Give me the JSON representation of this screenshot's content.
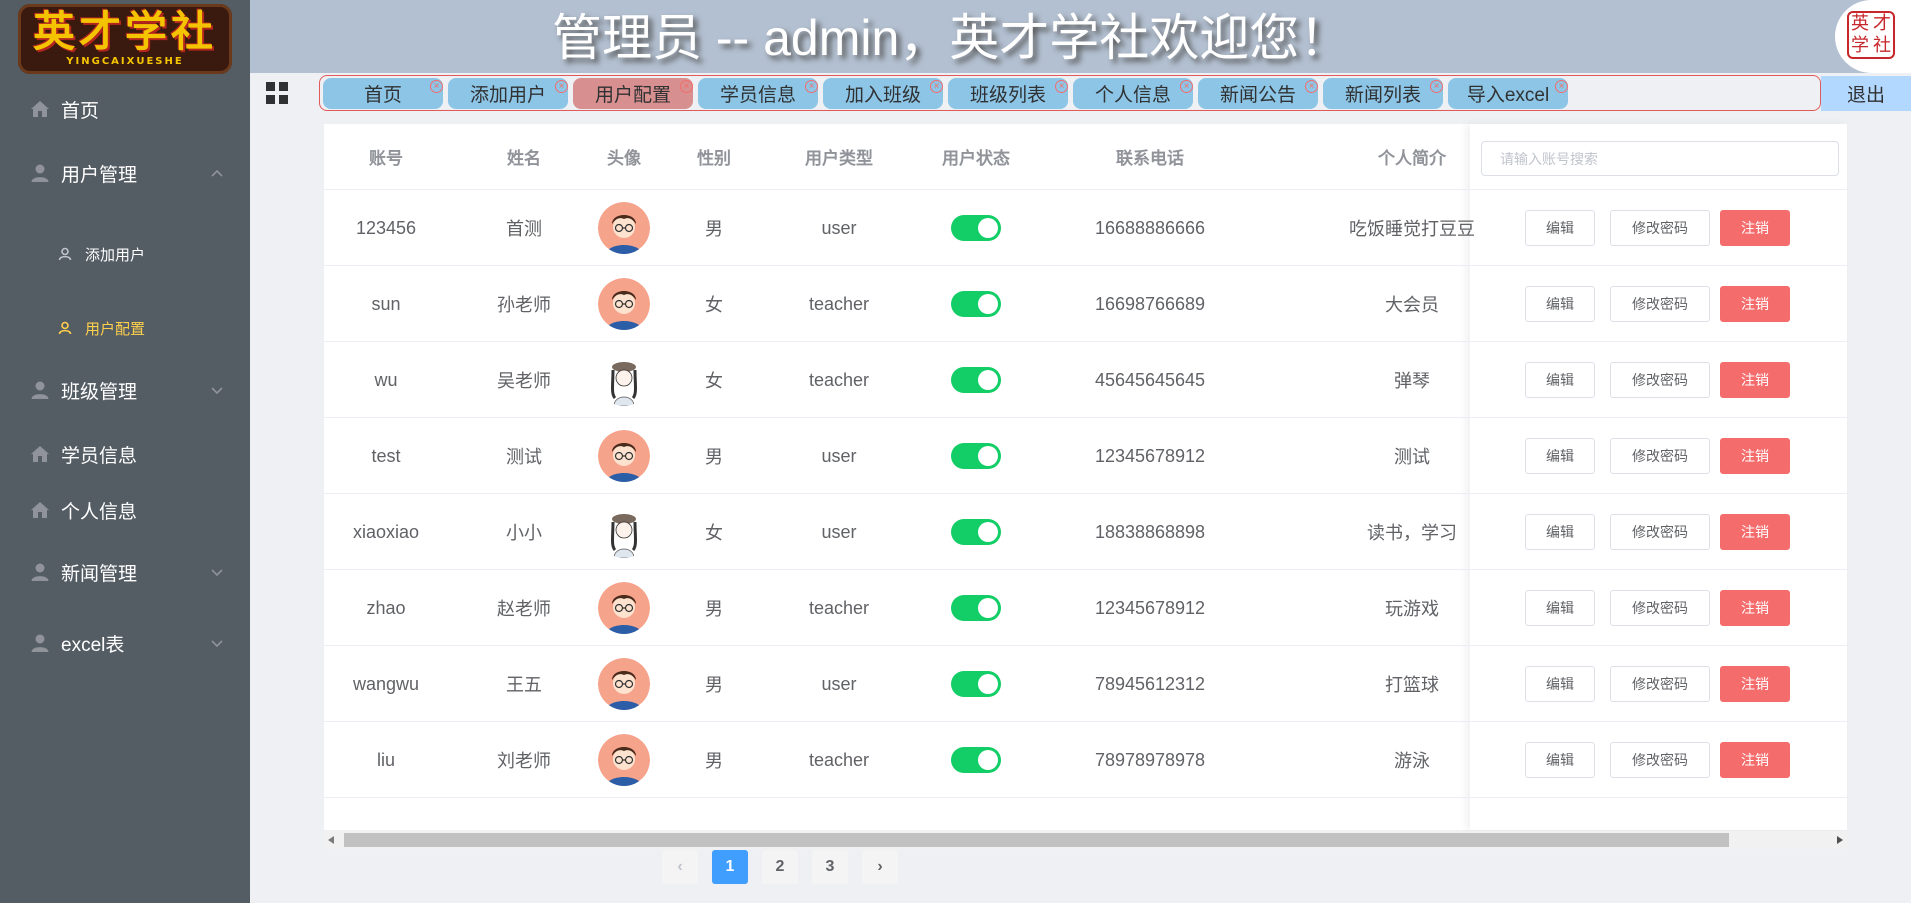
{
  "logo": {
    "main": "英才学社",
    "sub": "YINGCAIXUESHE"
  },
  "header": {
    "welcome": "管理员 -- admin，英才学社欢迎您！",
    "seal_chars": [
      "英",
      "才",
      "学",
      "社"
    ],
    "logout": "退出"
  },
  "sidebar": {
    "items": [
      {
        "label": "首页",
        "icon": "home-icon"
      },
      {
        "label": "用户管理",
        "icon": "user-icon",
        "expanded": true,
        "children": [
          {
            "label": "添加用户"
          },
          {
            "label": "用户配置",
            "active": true
          }
        ]
      },
      {
        "label": "班级管理",
        "icon": "user-icon"
      },
      {
        "label": "学员信息",
        "icon": "home-icon"
      },
      {
        "label": "个人信息",
        "icon": "home-icon"
      },
      {
        "label": "新闻管理",
        "icon": "user-icon"
      },
      {
        "label": "excel表",
        "icon": "user-icon"
      }
    ]
  },
  "tabs": [
    {
      "label": "首页"
    },
    {
      "label": "添加用户"
    },
    {
      "label": "用户配置",
      "active": true
    },
    {
      "label": "学员信息"
    },
    {
      "label": "加入班级"
    },
    {
      "label": "班级列表"
    },
    {
      "label": "个人信息"
    },
    {
      "label": "新闻公告"
    },
    {
      "label": "新闻列表"
    },
    {
      "label": "导入excel"
    }
  ],
  "table": {
    "columns": [
      "账号",
      "姓名",
      "头像",
      "性别",
      "用户类型",
      "用户状态",
      "联系电话",
      "个人简介"
    ],
    "search_placeholder": "请输入账号搜索",
    "actions": {
      "edit": "编辑",
      "change_password": "修改密码",
      "delete": "注销"
    },
    "rows": [
      {
        "account": "123456",
        "name": "首测",
        "avatar": "boy-avatar",
        "gender": "男",
        "type": "user",
        "status": true,
        "phone": "16688886666",
        "bio": "吃饭睡觉打豆豆"
      },
      {
        "account": "sun",
        "name": "孙老师",
        "avatar": "boy-avatar",
        "gender": "女",
        "type": "teacher",
        "status": true,
        "phone": "16698766689",
        "bio": "大会员"
      },
      {
        "account": "wu",
        "name": "吴老师",
        "avatar": "girl-avatar",
        "gender": "女",
        "type": "teacher",
        "status": true,
        "phone": "45645645645",
        "bio": "弹琴"
      },
      {
        "account": "test",
        "name": "测试",
        "avatar": "boy-avatar",
        "gender": "男",
        "type": "user",
        "status": true,
        "phone": "12345678912",
        "bio": "测试"
      },
      {
        "account": "xiaoxiao",
        "name": "小小",
        "avatar": "girl-avatar",
        "gender": "女",
        "type": "user",
        "status": true,
        "phone": "18838868898",
        "bio": "读书，学习"
      },
      {
        "account": "zhao",
        "name": "赵老师",
        "avatar": "boy-avatar",
        "gender": "男",
        "type": "teacher",
        "status": true,
        "phone": "12345678912",
        "bio": "玩游戏"
      },
      {
        "account": "wangwu",
        "name": "王五",
        "avatar": "boy-avatar",
        "gender": "男",
        "type": "user",
        "status": true,
        "phone": "78945612312",
        "bio": "打篮球"
      },
      {
        "account": "liu",
        "name": "刘老师",
        "avatar": "boy-avatar",
        "gender": "男",
        "type": "teacher",
        "status": true,
        "phone": "78978978978",
        "bio": "游泳"
      }
    ]
  },
  "pagination": {
    "pages": [
      "1",
      "2",
      "3"
    ],
    "current": "1",
    "prev": "‹",
    "next": "›"
  },
  "colors": {
    "sidebar": "#545c64",
    "active_menu": "#ffd04b",
    "header": "#b3c0d1",
    "switch_on": "#13ce66",
    "danger": "#f56c6c",
    "primary": "#409eff"
  }
}
